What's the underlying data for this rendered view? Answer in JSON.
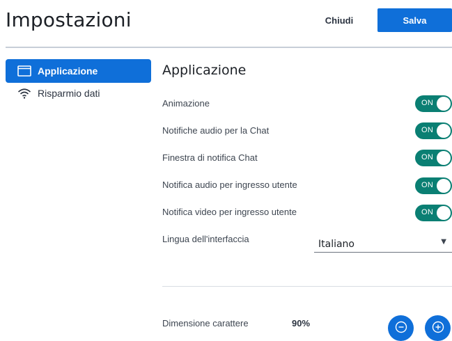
{
  "header": {
    "title": "Impostazioni",
    "close_label": "Chiudi",
    "save_label": "Salva"
  },
  "sidebar": {
    "items": [
      {
        "label": "Applicazione",
        "icon": "window-icon",
        "active": true
      },
      {
        "label": "Risparmio dati",
        "icon": "wifi-icon",
        "active": false
      }
    ]
  },
  "main": {
    "section_title": "Applicazione",
    "toggles": [
      {
        "label": "Animazione",
        "state": "ON"
      },
      {
        "label": "Notifiche audio per la Chat",
        "state": "ON"
      },
      {
        "label": "Finestra di notifica Chat",
        "state": "ON"
      },
      {
        "label": "Notifica audio per ingresso utente",
        "state": "ON"
      },
      {
        "label": "Notifica video per ingresso utente",
        "state": "ON"
      }
    ],
    "language": {
      "label": "Lingua dell'interfaccia",
      "selected": "Italiano"
    },
    "font_size": {
      "label": "Dimensione carattere",
      "value": "90%"
    }
  },
  "colors": {
    "accent": "#0f6fd9",
    "toggle_on": "#0a7f73"
  }
}
